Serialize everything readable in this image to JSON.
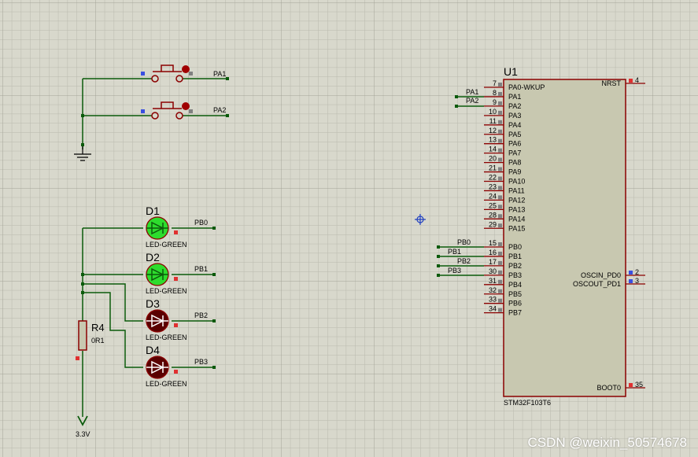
{
  "colors": {
    "wire": "#0b5a0b",
    "body": "#c8c8b0",
    "outline": "#8b0000",
    "pin_red": "#e03030",
    "pin_blue": "#3a4fe0",
    "led_on": "#2ddc2d",
    "led_off": "#5a0000",
    "text": "#000000"
  },
  "mcu": {
    "ref": "U1",
    "part": "STM32F103T6",
    "left_pins": [
      {
        "num": "7",
        "name": "PA0-WKUP"
      },
      {
        "num": "8",
        "name": "PA1"
      },
      {
        "num": "9",
        "name": "PA2"
      },
      {
        "num": "10",
        "name": "PA3"
      },
      {
        "num": "11",
        "name": "PA4"
      },
      {
        "num": "12",
        "name": "PA5"
      },
      {
        "num": "13",
        "name": "PA6"
      },
      {
        "num": "14",
        "name": "PA7"
      },
      {
        "num": "20",
        "name": "PA8"
      },
      {
        "num": "21",
        "name": "PA9"
      },
      {
        "num": "22",
        "name": "PA10"
      },
      {
        "num": "23",
        "name": "PA11"
      },
      {
        "num": "24",
        "name": "PA12"
      },
      {
        "num": "25",
        "name": "PA13"
      },
      {
        "num": "28",
        "name": "PA14"
      },
      {
        "num": "29",
        "name": "PA15"
      },
      {
        "num": "15",
        "name": "PB0"
      },
      {
        "num": "16",
        "name": "PB1"
      },
      {
        "num": "17",
        "name": "PB2"
      },
      {
        "num": "30",
        "name": "PB3"
      },
      {
        "num": "31",
        "name": "PB4"
      },
      {
        "num": "32",
        "name": "PB5"
      },
      {
        "num": "33",
        "name": "PB6"
      },
      {
        "num": "34",
        "name": "PB7"
      }
    ],
    "right_pins": [
      {
        "num": "4",
        "name": "NRST"
      },
      {
        "num": "2",
        "name": "OSCIN_PD0"
      },
      {
        "num": "3",
        "name": "OSCOUT_PD1"
      },
      {
        "num": "35",
        "name": "BOOT0"
      }
    ],
    "net_labels": [
      "PA1",
      "PA2",
      "PB0",
      "PB1",
      "PB2",
      "PB3"
    ]
  },
  "buttons": [
    {
      "net": "PA1"
    },
    {
      "net": "PA2"
    }
  ],
  "leds": [
    {
      "ref": "D1",
      "part": "LED-GREEN",
      "net": "PB0",
      "lit": true
    },
    {
      "ref": "D2",
      "part": "LED-GREEN",
      "net": "PB1",
      "lit": true
    },
    {
      "ref": "D3",
      "part": "LED-GREEN",
      "net": "PB2",
      "lit": false
    },
    {
      "ref": "D4",
      "part": "LED-GREEN",
      "net": "PB3",
      "lit": false
    }
  ],
  "resistor": {
    "ref": "R4",
    "value": "0R1"
  },
  "power": {
    "label": "3.3V"
  },
  "watermark": "CSDN @weixin_50574678"
}
